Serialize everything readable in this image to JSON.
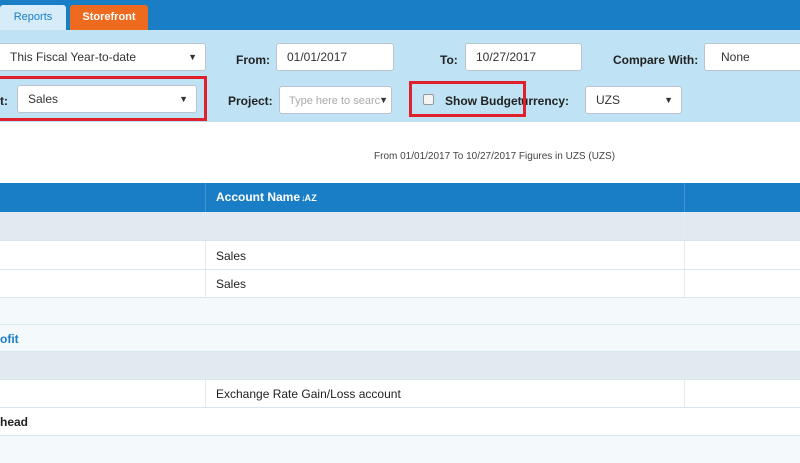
{
  "tabs": [
    {
      "label": "Reports"
    },
    {
      "label": "Storefront"
    }
  ],
  "filters": {
    "period": {
      "value": "This Fiscal Year-to-date"
    },
    "from": {
      "label": "From:",
      "value": "01/01/2017"
    },
    "to": {
      "label": "To:",
      "value": "10/27/2017"
    },
    "compare": {
      "label": "Compare With:",
      "value": "None"
    },
    "account": {
      "label_partial": "t:",
      "value": "Sales"
    },
    "project": {
      "label": "Project:",
      "placeholder": "Type here to searc"
    },
    "show_budget": {
      "label": "Show Budget",
      "checked": false
    },
    "currency": {
      "label_partial": "urrency:",
      "value": "UZS"
    }
  },
  "report": {
    "subtitle": "From 01/01/2017 To 10/27/2017 Figures in UZS (UZS)",
    "columns": [
      {
        "label": "Account Name",
        "sort_icon": "↓A Z"
      }
    ],
    "rows": [
      {
        "label": "",
        "account": ""
      },
      {
        "label": "",
        "account": "Sales"
      },
      {
        "label": "",
        "account": "Sales"
      },
      {
        "label": "",
        "account": ""
      },
      {
        "label": "ofit",
        "account": ""
      },
      {
        "label": "",
        "account": ""
      },
      {
        "label": "",
        "account": "Exchange Rate Gain/Loss account"
      },
      {
        "label": "head",
        "account": ""
      },
      {
        "label": "",
        "account": ""
      }
    ]
  },
  "colors": {
    "header_blue": "#1a7ec6",
    "filter_bg": "#bfe3f5",
    "storefront_tab": "#ee6a1f",
    "highlight_red": "#e0202a"
  }
}
